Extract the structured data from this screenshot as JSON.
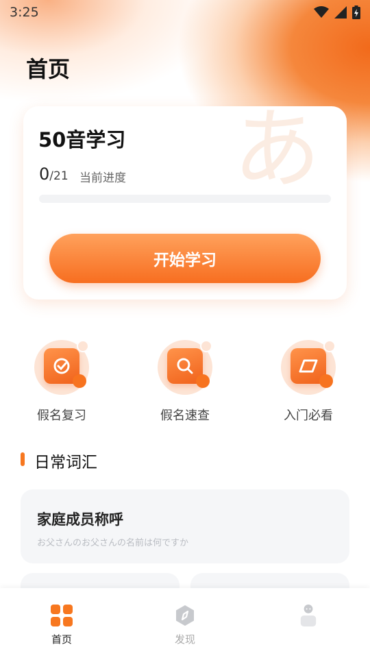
{
  "status_bar": {
    "time": "3:25"
  },
  "page": {
    "title": "首页"
  },
  "study_card": {
    "title": "50音学习",
    "watermark_char": "あ",
    "progress_current": "0",
    "progress_total": "/21",
    "progress_label": "当前进度",
    "progress_fraction": 0,
    "start_label": "开始学习"
  },
  "quick_actions": [
    {
      "label": "假名复习",
      "icon": "check-badge-icon"
    },
    {
      "label": "假名速查",
      "icon": "magnifier-icon"
    },
    {
      "label": "入门必看",
      "icon": "book-slant-icon"
    }
  ],
  "section": {
    "title": "日常词汇"
  },
  "vocab": [
    {
      "title": "家庭成员称呼",
      "subtitle": "お父さんのお父さんの名前は何ですか"
    }
  ],
  "tabbar": [
    {
      "label": "首页",
      "icon": "grid-icon",
      "active": true
    },
    {
      "label": "发现",
      "icon": "compass-icon",
      "active": false
    },
    {
      "label": "",
      "icon": "profile-icon",
      "active": false
    }
  ],
  "colors": {
    "accent": "#f7771f",
    "accent_light": "#ffa15c",
    "card_bg": "#f5f6f8"
  }
}
